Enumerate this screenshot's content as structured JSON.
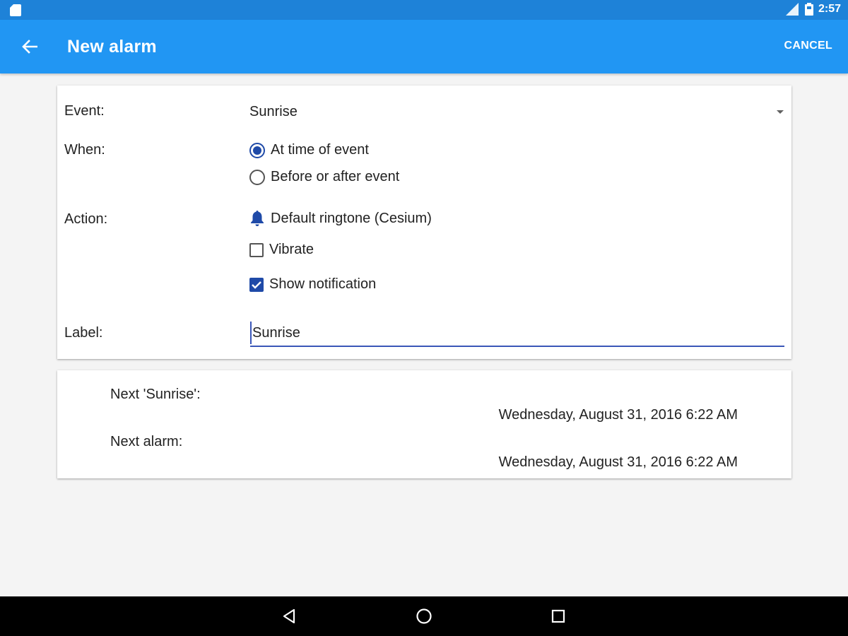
{
  "status_bar": {
    "time": "2:57",
    "icons": [
      "sd-card-icon",
      "signal-icon",
      "battery-icon"
    ]
  },
  "app_bar": {
    "back_icon": "arrow-back-icon",
    "title": "New alarm",
    "cancel_label": "CANCEL"
  },
  "form": {
    "event": {
      "label": "Event:",
      "value": "Sunrise"
    },
    "when": {
      "label": "When:",
      "options": [
        {
          "label": "At time of event",
          "selected": true
        },
        {
          "label": "Before or after event",
          "selected": false
        }
      ]
    },
    "action": {
      "label": "Action:",
      "ringtone": "Default ringtone (Cesium)",
      "ringtone_icon": "bell-icon",
      "vibrate": {
        "label": "Vibrate",
        "checked": false
      },
      "notification": {
        "label": "Show notification",
        "checked": true
      }
    },
    "label_field": {
      "label": "Label:",
      "value": "Sunrise"
    }
  },
  "next": {
    "event_label": "Next 'Sunrise':",
    "event_value": "Wednesday, August 31, 2016 6:22 AM",
    "alarm_label": "Next alarm:",
    "alarm_value": "Wednesday, August 31, 2016 6:22 AM"
  },
  "colors": {
    "status_bar": "#1e82d8",
    "app_bar": "#2196f3",
    "accent": "#1f4aa8"
  }
}
